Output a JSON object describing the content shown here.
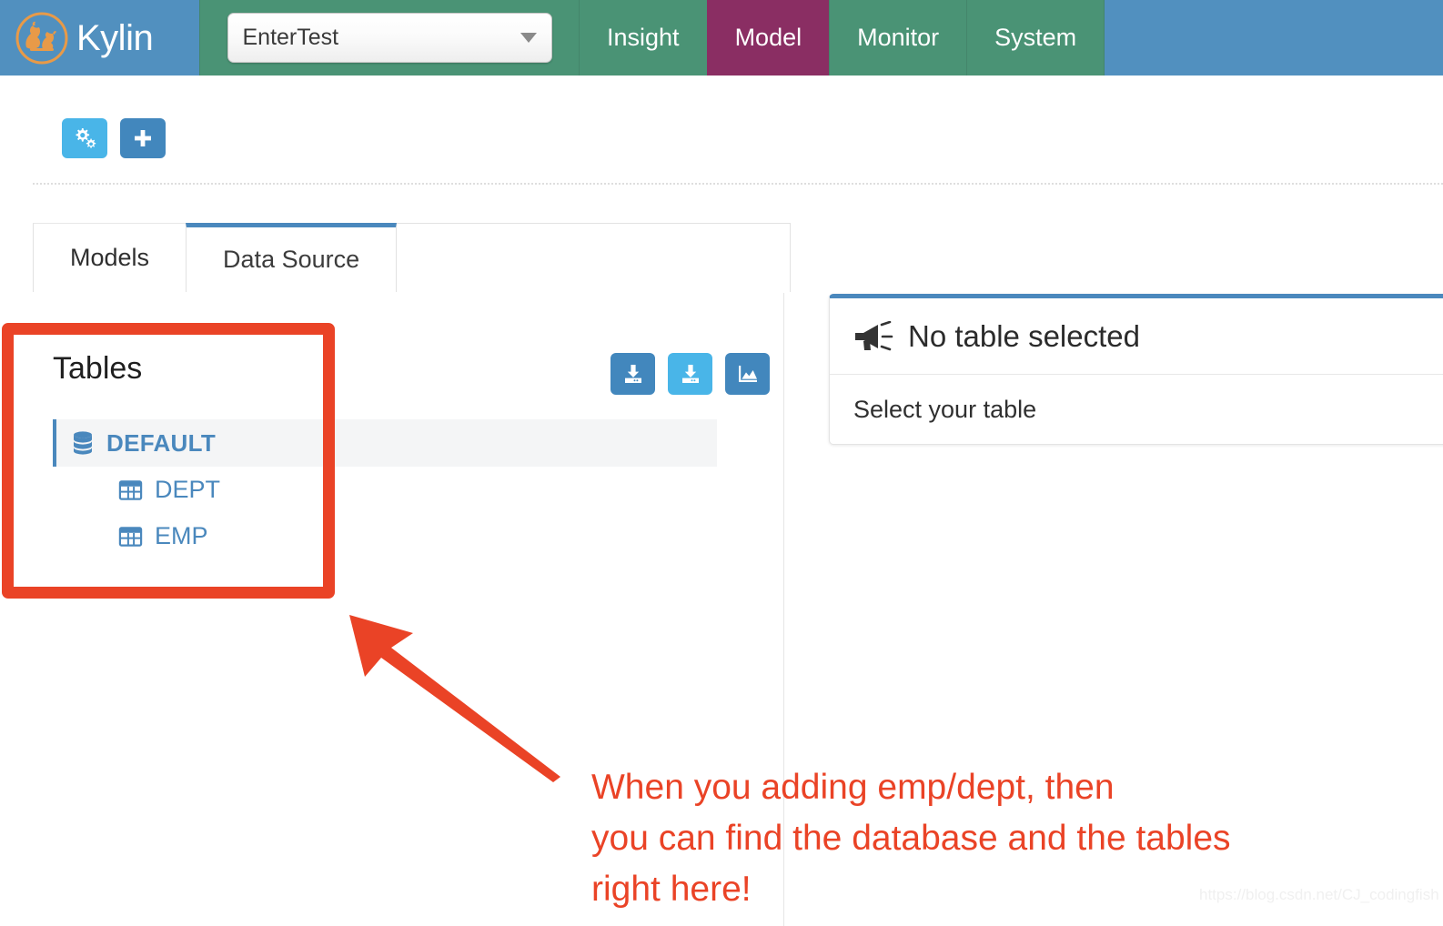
{
  "header": {
    "brand_name": "Kylin",
    "brand_logo_icon": "kylin-logo-icon",
    "project_selector": {
      "value": "EnterTest",
      "caret_icon": "chevron-down-icon"
    },
    "nav_items": [
      {
        "label": "Insight",
        "active": false
      },
      {
        "label": "Model",
        "active": true
      },
      {
        "label": "Monitor",
        "active": false
      },
      {
        "label": "System",
        "active": false
      }
    ],
    "colors": {
      "brand_bg": "#5190bf",
      "nav_bg": "#4a9375",
      "nav_active_bg": "#8a2e63"
    }
  },
  "toolbar": {
    "buttons": [
      {
        "name": "settings-gears-button",
        "icon": "gears-icon",
        "style": "light"
      },
      {
        "name": "add-button",
        "icon": "plus-icon",
        "style": "dark"
      }
    ]
  },
  "tabs": [
    {
      "label": "Models",
      "active": false
    },
    {
      "label": "Data Source",
      "active": true
    }
  ],
  "left_panel": {
    "title": "Tables",
    "actions": [
      {
        "name": "load-table-button",
        "icon": "download-table-icon",
        "style": "dark"
      },
      {
        "name": "load-table-from-tree-button",
        "icon": "download-table-icon",
        "style": "light"
      },
      {
        "name": "load-hive-chart-button",
        "icon": "chart-icon",
        "style": "dark"
      }
    ],
    "tree": {
      "database": {
        "label": "DEFAULT",
        "icon": "database-icon",
        "selected": true
      },
      "tables": [
        {
          "label": "DEPT",
          "icon": "table-grid-icon"
        },
        {
          "label": "EMP",
          "icon": "table-grid-icon"
        }
      ]
    }
  },
  "right_card": {
    "header_icon": "megaphone-icon",
    "header_title": "No table selected",
    "body_text": "Select your table",
    "accent_color": "#4a88bd"
  },
  "annotations": {
    "color": "#ea4326",
    "highlight_box_name": "tables-highlight-box",
    "arrow_name": "pointer-arrow",
    "text_lines": [
      "When you adding emp/dept, then",
      "you can find the database and the tables",
      "right here!"
    ]
  },
  "watermark": "https://blog.csdn.net/CJ_codingfish"
}
